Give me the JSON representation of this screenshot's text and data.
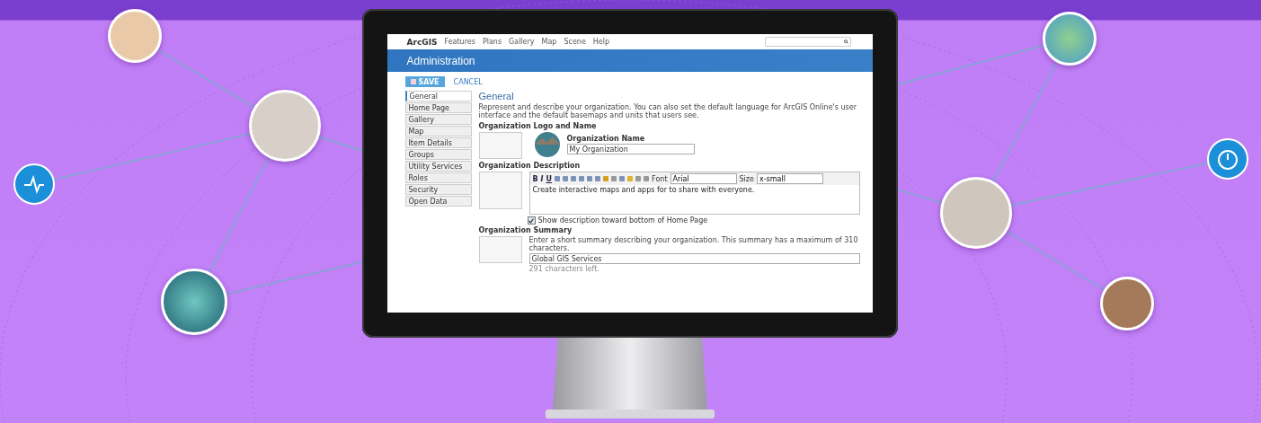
{
  "screen": {
    "nav": {
      "logo": "ArcGIS",
      "items": [
        "Features",
        "Plans",
        "Gallery",
        "Map",
        "Scene",
        "Help"
      ]
    },
    "banner": {
      "title": "Administration"
    },
    "actions": {
      "save": "SAVE",
      "cancel": "CANCEL"
    },
    "sidebar": {
      "items": [
        {
          "label": "General",
          "selected": true
        },
        {
          "label": "Home Page",
          "selected": false
        },
        {
          "label": "Gallery",
          "selected": false
        },
        {
          "label": "Map",
          "selected": false
        },
        {
          "label": "Item Details",
          "selected": false
        },
        {
          "label": "Groups",
          "selected": false
        },
        {
          "label": "Utility Services",
          "selected": false
        },
        {
          "label": "Roles",
          "selected": false
        },
        {
          "label": "Security",
          "selected": false
        },
        {
          "label": "Open Data",
          "selected": false
        }
      ]
    },
    "content": {
      "heading": "General",
      "intro": "Represent and describe your organization. You can also set the default language for ArcGIS Online's user interface and the default basemaps and units that users see.",
      "logo_section": {
        "title": "Organization Logo and Name",
        "name_label": "Organization Name",
        "name_value": "My Organization"
      },
      "description": {
        "title": "Organization Description",
        "format_buttons": [
          "B",
          "I",
          "U"
        ],
        "font_label": "Font",
        "font_value": "Arial",
        "size_label": "Size",
        "size_value": "x-small",
        "text": "Create interactive maps and apps for to share with everyone.",
        "show_option": {
          "label": "Show description toward bottom of Home Page",
          "checked": true
        }
      },
      "summary": {
        "title": "Organization Summary",
        "hint": "Enter a short summary describing your organization. This summary has a maximum of 310 characters.",
        "value": "Global GIS Services",
        "counter": "291 characters left."
      }
    }
  }
}
